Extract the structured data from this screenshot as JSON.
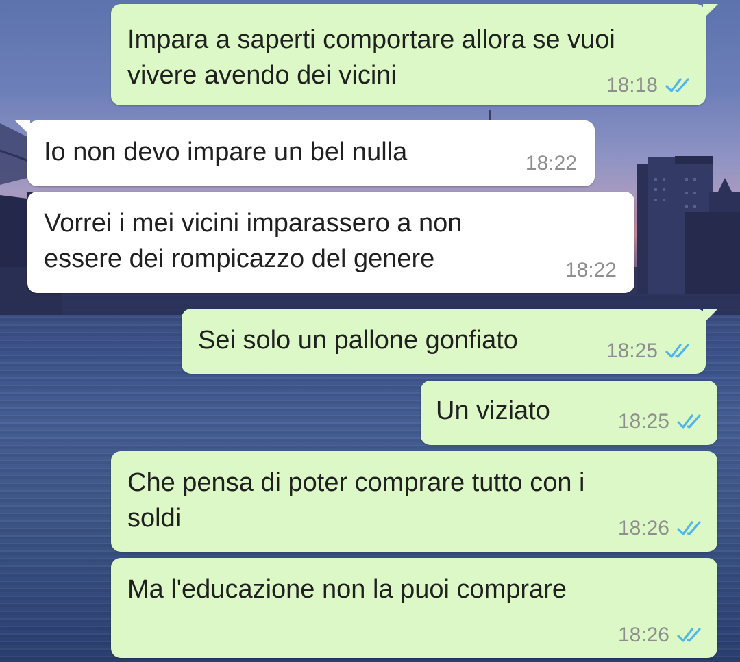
{
  "colors": {
    "outgoing_bubble": "#dcf8c6",
    "incoming_bubble": "#ffffff",
    "read_ticks": "#4fb6ec",
    "time_text": "#8e8e8e"
  },
  "messages": [
    {
      "direction": "outgoing",
      "text": "Impara a saperti comportare allora se vuoi\nvivere avendo dei vicini",
      "time": "18:18",
      "status": "read"
    },
    {
      "direction": "incoming",
      "text": "Io non devo impare un bel nulla",
      "time": "18:22"
    },
    {
      "direction": "incoming",
      "text": "Vorrei i mei vicini imparassero a non\nessere dei rompicazzo del genere",
      "time": "18:22"
    },
    {
      "direction": "outgoing",
      "text": "Sei solo un pallone gonfiato",
      "time": "18:25",
      "status": "read"
    },
    {
      "direction": "outgoing",
      "text": "Un viziato",
      "time": "18:25",
      "status": "read"
    },
    {
      "direction": "outgoing",
      "text": "Che pensa di poter comprare tutto con i\nsoldi",
      "time": "18:26",
      "status": "read"
    },
    {
      "direction": "outgoing",
      "text": "Ma l'educazione non la puoi comprare",
      "time": "18:26",
      "status": "read"
    }
  ]
}
